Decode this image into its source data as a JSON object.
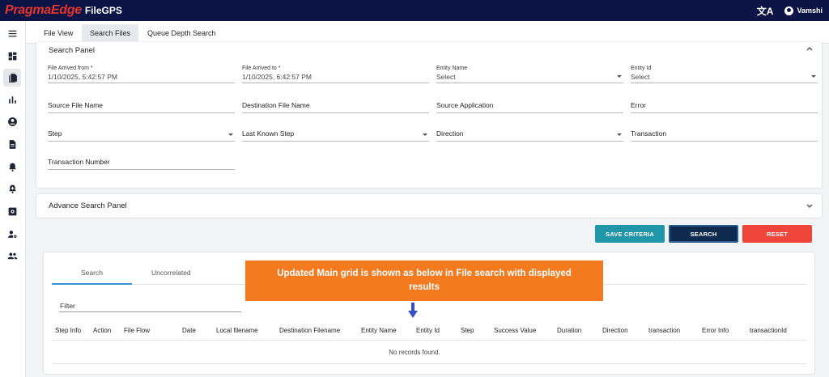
{
  "header": {
    "logo": "PragmaEdge",
    "product": "FileGPS",
    "translate_glyph": "文A",
    "user_name": "Vamshi"
  },
  "sidebar": {
    "items": [
      {
        "icon": "menu-icon"
      },
      {
        "icon": "dashboard-icon"
      },
      {
        "icon": "files-icon",
        "active": true
      },
      {
        "icon": "bar-chart-icon"
      },
      {
        "icon": "account-circle-icon"
      },
      {
        "icon": "document-icon"
      },
      {
        "icon": "alert-icon"
      },
      {
        "icon": "alert-add-icon"
      },
      {
        "icon": "settings-box-icon"
      },
      {
        "icon": "user-settings-icon"
      },
      {
        "icon": "people-icon"
      }
    ]
  },
  "tabs": {
    "file_view": "File View",
    "search_files": "Search Files",
    "queue_depth": "Queue Depth Search",
    "active": "Search Files"
  },
  "search_panel": {
    "title": "Search Panel",
    "file_arrived_from": {
      "label": "File Arrived from *",
      "value": "1/10/2025, 5:42:57 PM"
    },
    "file_arrived_to": {
      "label": "File Arrived to *",
      "value": "1/10/2025, 6:42:57 PM"
    },
    "entity_name": {
      "label": "Entity Name",
      "value": "Select"
    },
    "entity_id": {
      "label": "Entity Id",
      "value": "Select"
    },
    "source_file_name": "Source File Name",
    "destination_file_name": "Destination File Name",
    "source_application": "Source Application",
    "error": "Error",
    "step": "Step",
    "last_known_step": "Last Known Step",
    "direction": "Direction",
    "transaction": "Transaction",
    "transaction_number": "Transaction Number"
  },
  "advance_panel": {
    "title": "Advance Search Panel"
  },
  "buttons": {
    "save_criteria": "SAVE CRITERIA",
    "search": "SEARCH",
    "reset": "RESET"
  },
  "results": {
    "tabs": [
      "Search",
      "Uncorrelated"
    ],
    "active_tab": "Search",
    "filter_placeholder": "Filter",
    "columns": [
      "Step Info",
      "Action",
      "File Flow",
      "Date",
      "Local filename",
      "Destination Filename",
      "Entity Name",
      "Entity Id",
      "Step",
      "Success Value",
      "Duration",
      "Direction",
      "transaction",
      "Error Info",
      "transactionId"
    ],
    "empty_message": "No records found."
  },
  "annotation": {
    "text": "Updated Main grid is shown as below in File search  with displayed results"
  },
  "colors": {
    "topbar": "#0c1445",
    "logo": "#e3342f",
    "save_criteria": "#2196a8",
    "search": "#0f2a4f",
    "reset": "#f0453a",
    "callout": "#f47a20",
    "arrow": "#3a4fc2",
    "active_underline": "#3b8fd4"
  }
}
